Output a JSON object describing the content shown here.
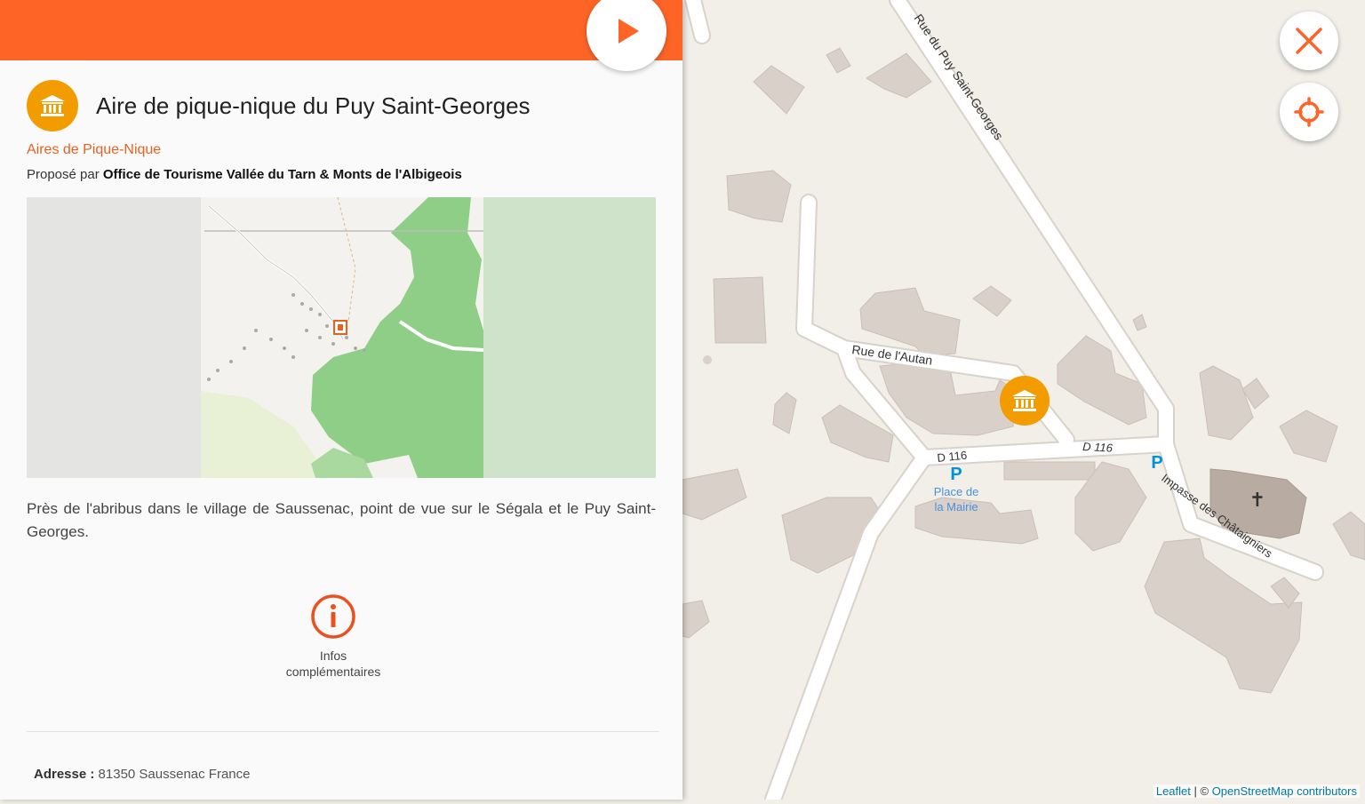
{
  "panel": {
    "title": "Aire de pique-nique du Puy Saint-Georges",
    "category": "Aires de Pique-Nique",
    "proposed_by_prefix": "Proposé par",
    "proposed_by_org": "Office de Tourisme Vallée du Tarn & Monts de l'Albigeois",
    "description": "Près de l'abribus dans le village de Saussenac, point de vue sur le Ségala et le Puy Saint-Georges.",
    "info_label_line1": "Infos",
    "info_label_line2": "complémentaires",
    "address_label": "Adresse :",
    "address_value": "81350 Saussenac France",
    "poi_icon": "monument-icon",
    "play_icon": "play-icon"
  },
  "map": {
    "street_labels": {
      "rue_puy": "Rue du Puy Saint-Georges",
      "rue_autan": "Rue de l'Autan",
      "d116_left": "D 116",
      "d116_right": "D 116",
      "impasse": "Impasse des Châtaigniers",
      "place_mairie_line1": "Place de",
      "place_mairie_line2": "la Mairie",
      "parking_symbol": "P"
    },
    "attribution_leaflet": "Leaflet",
    "attribution_sep": " | © ",
    "attribution_osm": "OpenStreetMap contributors"
  },
  "controls": {
    "close_icon": "close-icon",
    "locate_icon": "locate-icon"
  },
  "colors": {
    "accent": "#ff6427",
    "poi": "#f39c00",
    "category_text": "#e8621e",
    "forest": "#8fce86",
    "building": "#d9d0c9",
    "road": "#ffffff",
    "map_bg": "#f2efe9",
    "parking": "#0092da"
  }
}
